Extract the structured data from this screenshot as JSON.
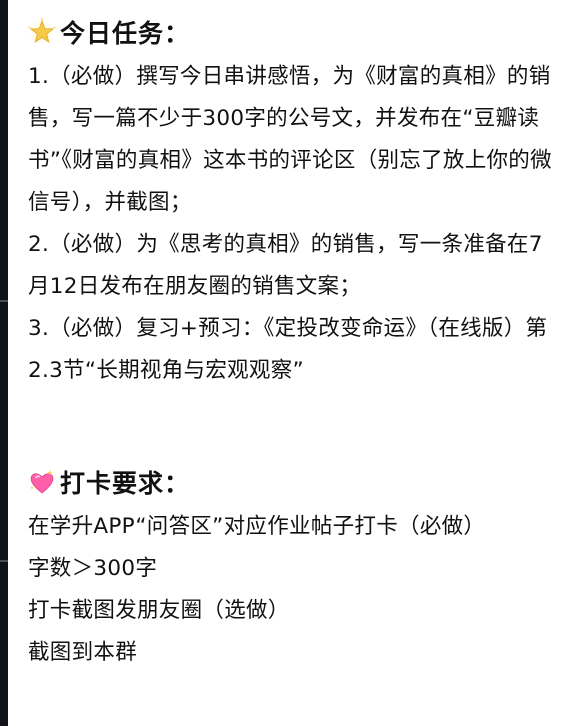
{
  "tasks": {
    "title": "今日任务：",
    "title_icon": "glowing-star-icon",
    "items": [
      "1.（必做）撰写今日串讲感悟，为《财富的真相》的销售，写一篇不少于300字的公号文，并发布在“豆瓣读书”《财富的真相》这本书的评论区（别忘了放上你的微信号），并截图；",
      "2.（必做）为《思考的真相》的销售，写一条准备在7月12日发布在朋友圈的销售文案；",
      "3.（必做）复习+预习：《定投改变命运》（在线版）第2.3节“长期视角与宏观观察”"
    ]
  },
  "checkin": {
    "title": "打卡要求：",
    "title_icon": "sparkling-heart-icon",
    "items": [
      "在学升APP“问答区”对应作业帖子打卡（必做）",
      "字数＞300字",
      "打卡截图发朋友圈（选做）",
      "截图到本群"
    ]
  },
  "colors": {
    "text": "#111111",
    "background": "#ffffff",
    "star": "#f7c948",
    "heart": "#ff5fa8"
  }
}
